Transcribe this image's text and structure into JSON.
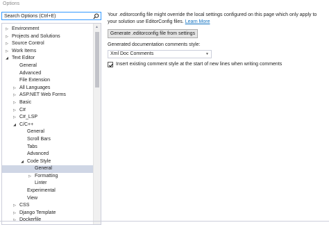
{
  "window": {
    "title": "Options"
  },
  "search": {
    "placeholder": "Search Options (Ctrl+E)"
  },
  "tree": [
    {
      "label": "Environment",
      "level": 0,
      "arrow": "collapsed"
    },
    {
      "label": "Projects and Solutions",
      "level": 0,
      "arrow": "collapsed"
    },
    {
      "label": "Source Control",
      "level": 0,
      "arrow": "collapsed"
    },
    {
      "label": "Work Items",
      "level": 0,
      "arrow": "collapsed"
    },
    {
      "label": "Text Editor",
      "level": 0,
      "arrow": "expanded"
    },
    {
      "label": "General",
      "level": 1,
      "arrow": "none"
    },
    {
      "label": "Advanced",
      "level": 1,
      "arrow": "none"
    },
    {
      "label": "File Extension",
      "level": 1,
      "arrow": "none"
    },
    {
      "label": "All Languages",
      "level": 1,
      "arrow": "collapsed"
    },
    {
      "label": "ASP.NET Web Forms",
      "level": 1,
      "arrow": "collapsed"
    },
    {
      "label": "Basic",
      "level": 1,
      "arrow": "collapsed"
    },
    {
      "label": "C#",
      "level": 1,
      "arrow": "collapsed"
    },
    {
      "label": "C#_LSP",
      "level": 1,
      "arrow": "collapsed"
    },
    {
      "label": "C/C++",
      "level": 1,
      "arrow": "expanded"
    },
    {
      "label": "General",
      "level": 2,
      "arrow": "none"
    },
    {
      "label": "Scroll Bars",
      "level": 2,
      "arrow": "none"
    },
    {
      "label": "Tabs",
      "level": 2,
      "arrow": "none"
    },
    {
      "label": "Advanced",
      "level": 2,
      "arrow": "none"
    },
    {
      "label": "Code Style",
      "level": 2,
      "arrow": "expanded"
    },
    {
      "label": "General",
      "level": 3,
      "arrow": "none",
      "selected": true
    },
    {
      "label": "Formatting",
      "level": 3,
      "arrow": "collapsed"
    },
    {
      "label": "Linter",
      "level": 3,
      "arrow": "none"
    },
    {
      "label": "Experimental",
      "level": 2,
      "arrow": "none"
    },
    {
      "label": "View",
      "level": 2,
      "arrow": "none"
    },
    {
      "label": "CSS",
      "level": 1,
      "arrow": "collapsed"
    },
    {
      "label": "Django Template",
      "level": 1,
      "arrow": "collapsed"
    },
    {
      "label": "Dockerfile",
      "level": 1,
      "arrow": "collapsed"
    }
  ],
  "panel": {
    "notice_text": "Your .editorconfig file might override the local settings configured on this page which only apply to your solution use EditorConfig files.",
    "learn_more": "Learn More",
    "generate_button": "Generate .editorconfig file from settings",
    "doc_comments_label": "Generated documentation comments style:",
    "doc_comments_value": "Xml Doc Comments",
    "insert_comment_label": "Insert existing comment style at the start of new lines when writing comments",
    "insert_comment_checked": true
  },
  "icons": {
    "search": "search-icon",
    "tree_collapsed": "chevron-right-icon",
    "tree_expanded": "chevron-down-icon",
    "dropdown": "chevron-down-icon",
    "check": "checkmark-icon"
  },
  "colors": {
    "accent": "#3399ff",
    "link": "#0e70c0",
    "selection": "#cfd6e5"
  }
}
